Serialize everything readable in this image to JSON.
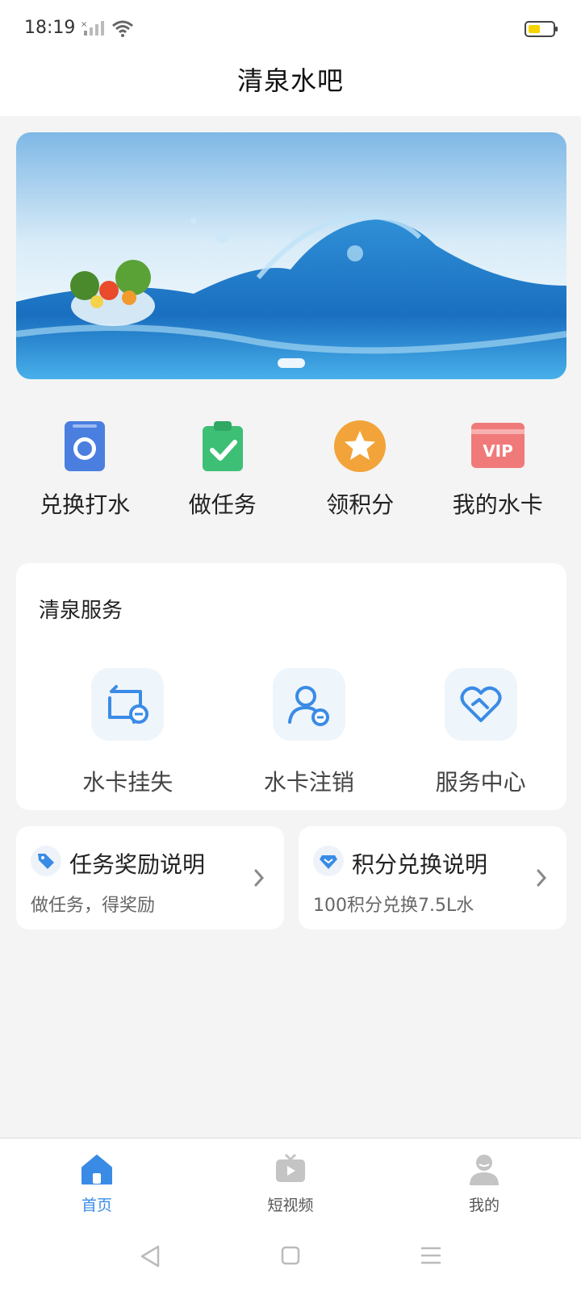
{
  "status_bar": {
    "time": "18:19"
  },
  "header": {
    "title": "清泉水吧"
  },
  "quick_actions": [
    {
      "label": "兑换打水",
      "icon": "washer-icon",
      "color": "#4a7fe0"
    },
    {
      "label": "做任务",
      "icon": "clipboard-check-icon",
      "color": "#3dbf76"
    },
    {
      "label": "领积分",
      "icon": "star-badge-icon",
      "color": "#f2a43a"
    },
    {
      "label": "我的水卡",
      "icon": "vip-card-icon",
      "color": "#f07a7a"
    }
  ],
  "services": {
    "title": "清泉服务",
    "items": [
      {
        "label": "水卡挂失",
        "icon": "card-report-loss-icon"
      },
      {
        "label": "水卡注销",
        "icon": "user-remove-icon"
      },
      {
        "label": "服务中心",
        "icon": "heart-handshake-icon"
      }
    ]
  },
  "info_cards": [
    {
      "title": "任务奖励说明",
      "subtitle": "做任务，得奖励",
      "icon": "tag-icon"
    },
    {
      "title": "积分兑换说明",
      "subtitle": "100积分兑换7.5L水",
      "icon": "diamond-icon"
    }
  ],
  "bottom_nav": [
    {
      "label": "首页",
      "icon": "home-icon",
      "active": true
    },
    {
      "label": "短视频",
      "icon": "tv-play-icon",
      "active": false
    },
    {
      "label": "我的",
      "icon": "user-icon",
      "active": false
    }
  ],
  "colors": {
    "accent": "#3a8be6",
    "background": "#f4f4f4",
    "service_icon": "#3a8be6"
  }
}
